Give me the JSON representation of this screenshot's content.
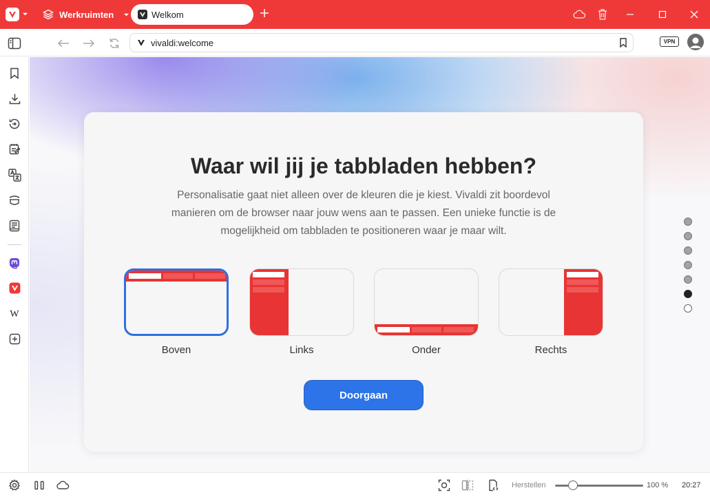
{
  "colors": {
    "accent_red": "#ef3939",
    "primary_blue": "#2d74e8",
    "selected_border": "#2e6fe0"
  },
  "topbar": {
    "workspaces_label": "Werkruimten",
    "tab_title": "Welkom",
    "icons": [
      "vivaldi-logo",
      "layers-icon",
      "cloud-icon",
      "trash-icon",
      "minimize-icon",
      "maximize-icon",
      "close-icon"
    ]
  },
  "addressbar": {
    "url": "vivaldi:welcome",
    "vpn_label": "VPN"
  },
  "content": {
    "title": "Waar wil jij je tabbladen hebben?",
    "description": "Personalisatie gaat niet alleen over de kleuren die je kiest. Vivaldi zit boordevol manieren om de browser naar jouw wens aan te passen. Een unieke functie is de mogelijkheid om tabbladen te positioneren waar je maar wilt.",
    "options": [
      {
        "label": "Boven",
        "selected": true
      },
      {
        "label": "Links",
        "selected": false
      },
      {
        "label": "Onder",
        "selected": false
      },
      {
        "label": "Rechts",
        "selected": false
      }
    ],
    "continue_label": "Doorgaan",
    "steps_total": 7,
    "step_current": 6
  },
  "statusbar": {
    "reset_label": "Herstellen",
    "zoom": "100 %",
    "zoom_fraction": 0.2,
    "time": "20:27"
  }
}
